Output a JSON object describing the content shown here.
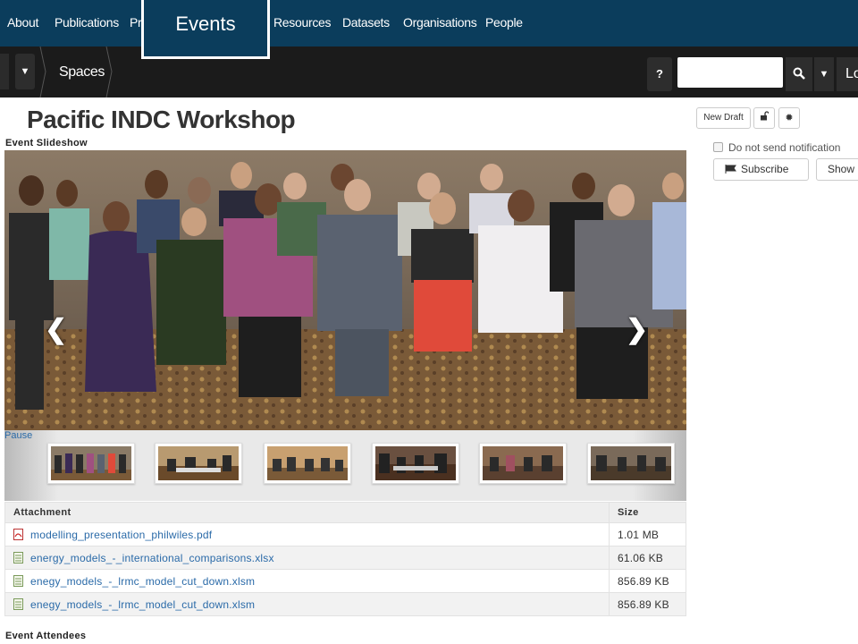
{
  "topnav": {
    "items": [
      "About",
      "Publications",
      "Pr",
      "Resources",
      "Datasets",
      "Organisations",
      "People"
    ],
    "active_tab": "Events"
  },
  "subnav": {
    "breadcrumb": "Spaces",
    "help": "?",
    "login": "Lo"
  },
  "page": {
    "title": "Pacific INDC Workshop",
    "new_draft": "New Draft",
    "notify_label": "Do not send notification",
    "subscribe": "Subscribe",
    "show": "Show"
  },
  "slideshow": {
    "label": "Event Slideshow",
    "pause": "Pause",
    "prev": "❮",
    "next": "❯",
    "thumbnail_count": 6
  },
  "attachments": {
    "headers": [
      "Attachment",
      "Size"
    ],
    "rows": [
      {
        "name": "modelling_presentation_philwiles.pdf",
        "size": "1.01 MB",
        "type": "pdf"
      },
      {
        "name": "energy_models_-_international_comparisons.xlsx",
        "size": "61.06 KB",
        "type": "sheet"
      },
      {
        "name": "enegy_models_-_lrmc_model_cut_down.xlsm",
        "size": "856.89 KB",
        "type": "sheet"
      },
      {
        "name": "enegy_models_-_lrmc_model_cut_down.xlsm",
        "size": "856.89 KB",
        "type": "sheet"
      }
    ]
  },
  "attendees": {
    "label": "Event Attendees"
  },
  "colors": {
    "nav_bg": "#0b3d5c",
    "subnav_bg": "#1b1b1b",
    "link": "#2a6aa8"
  }
}
